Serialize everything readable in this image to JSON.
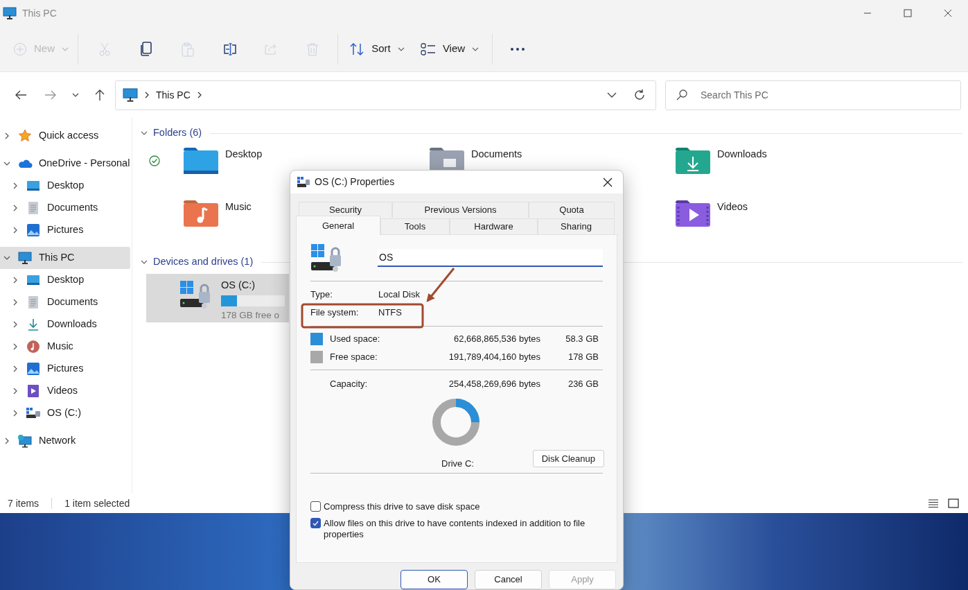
{
  "window": {
    "title": "This PC"
  },
  "toolbar": [
    {
      "kind": "new",
      "label": "New",
      "disabled": true
    },
    {
      "kind": "cut",
      "disabled": true
    },
    {
      "kind": "copy",
      "disabled": false
    },
    {
      "kind": "paste",
      "disabled": true
    },
    {
      "kind": "rename",
      "disabled": false
    },
    {
      "kind": "share",
      "disabled": true
    },
    {
      "kind": "delete",
      "disabled": true
    },
    {
      "kind": "sort",
      "label": "Sort",
      "disabled": false
    },
    {
      "kind": "view",
      "label": "View",
      "disabled": false
    },
    {
      "kind": "more",
      "disabled": false
    }
  ],
  "address": {
    "path": [
      "This PC"
    ]
  },
  "search": {
    "placeholder": "Search This PC"
  },
  "sidebar": {
    "items": [
      {
        "label": "Quick access",
        "kind": "star",
        "expanded": false,
        "selected": false
      },
      {
        "label": "OneDrive - Personal",
        "kind": "cloud",
        "expanded": true,
        "selected": false,
        "children": [
          {
            "label": "Desktop",
            "kind": "desktop",
            "expanded": false,
            "selected": false
          },
          {
            "label": "Documents",
            "kind": "documents",
            "expanded": false,
            "selected": false
          },
          {
            "label": "Pictures",
            "kind": "pictures",
            "expanded": false,
            "selected": false
          }
        ]
      },
      {
        "label": "This PC",
        "kind": "pc",
        "expanded": true,
        "selected": true,
        "children": [
          {
            "label": "Desktop",
            "kind": "desktop",
            "expanded": false,
            "selected": false
          },
          {
            "label": "Documents",
            "kind": "documents",
            "expanded": false,
            "selected": false
          },
          {
            "label": "Downloads",
            "kind": "downloads",
            "expanded": false,
            "selected": false
          },
          {
            "label": "Music",
            "kind": "music",
            "expanded": false,
            "selected": false
          },
          {
            "label": "Pictures",
            "kind": "pictures",
            "expanded": false,
            "selected": false
          },
          {
            "label": "Videos",
            "kind": "videos",
            "expanded": false,
            "selected": false
          },
          {
            "label": "OS (C:)",
            "kind": "drive",
            "expanded": false,
            "selected": false
          }
        ]
      },
      {
        "label": "Network",
        "kind": "network",
        "expanded": false,
        "selected": false
      }
    ]
  },
  "folders": {
    "title": "Folders (6)",
    "expanded": true,
    "items": [
      {
        "name": "Desktop",
        "kind": "desktop",
        "synced": true
      },
      {
        "name": "Documents",
        "kind": "documents",
        "synced": false
      },
      {
        "name": "Downloads",
        "kind": "downloads",
        "synced": false
      },
      {
        "name": "Music",
        "kind": "music",
        "synced": false
      },
      {
        "name": "Videos",
        "kind": "videos",
        "synced": false
      }
    ]
  },
  "drives": {
    "title": "Devices and drives (1)",
    "expanded": true,
    "items": [
      {
        "name": "OS (C:)",
        "level": 0.25,
        "free": "178 GB free o",
        "selected": true
      }
    ]
  },
  "status_bar": {
    "count": "7 items",
    "selection": "1 item selected"
  },
  "dialog": {
    "title": "OS (C:) Properties",
    "tab_rows": [
      [
        {
          "label": "Security",
          "selected": false
        },
        {
          "label": "Previous Versions",
          "selected": false
        },
        {
          "label": "Quota",
          "selected": false
        }
      ],
      [
        {
          "label": "General",
          "selected": true
        },
        {
          "label": "Tools",
          "selected": false
        },
        {
          "label": "Hardware",
          "selected": false
        },
        {
          "label": "Sharing",
          "selected": false
        }
      ]
    ],
    "name_field": {
      "value": "OS"
    },
    "info": [
      {
        "label": "Type:",
        "value": "Local Disk"
      },
      {
        "label": "File system:",
        "value": "NTFS"
      }
    ],
    "space": [
      {
        "label": "Used space:",
        "bytes": "62,668,865,536 bytes",
        "size": "58.3 GB",
        "color": "#2b8fd8"
      },
      {
        "label": "Free space:",
        "bytes": "191,789,404,160 bytes",
        "size": "178 GB",
        "color": "#a8a8a8"
      }
    ],
    "capacity": {
      "label": "Capacity:",
      "bytes": "254,458,269,696 bytes",
      "size": "236 GB"
    },
    "usage": {
      "level": 0.25
    },
    "drive_label": "Drive C:",
    "cleanup_button": "Disk Cleanup",
    "checkboxes": [
      {
        "label": "Compress this drive to save disk space",
        "checked": false
      },
      {
        "label": "Allow files on this drive to have contents indexed in addition to file properties",
        "checked": true
      }
    ],
    "buttons": [
      {
        "label": "OK",
        "default": true,
        "disabled": false
      },
      {
        "label": "Cancel",
        "default": false,
        "disabled": false
      },
      {
        "label": "Apply",
        "default": false,
        "disabled": true
      }
    ]
  }
}
